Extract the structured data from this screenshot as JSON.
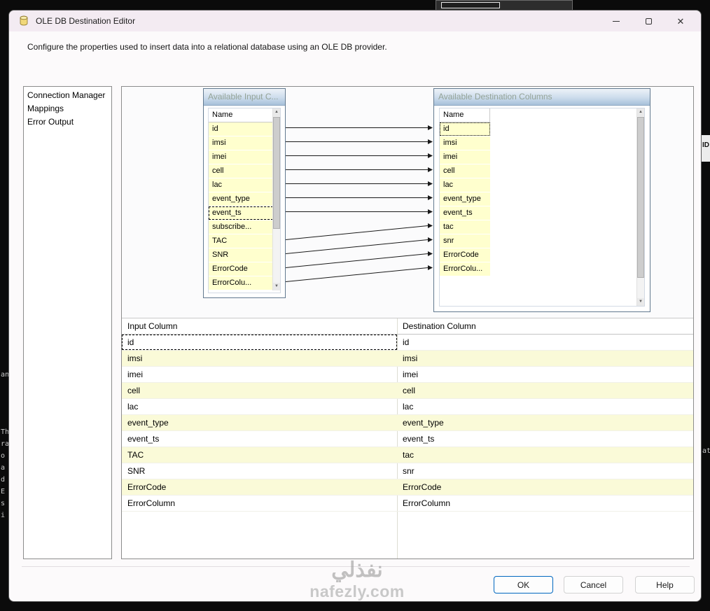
{
  "window": {
    "title": "OLE DB Destination Editor",
    "description": "Configure the properties used to insert data into a relational database using an OLE DB provider."
  },
  "icons": {
    "close": "✕",
    "scroll_up": "▲",
    "scroll_down": "▼"
  },
  "sidebar": {
    "items": [
      {
        "label": "Connection Manager",
        "selected": false
      },
      {
        "label": "Mappings",
        "selected": true
      },
      {
        "label": "Error Output",
        "selected": false
      }
    ]
  },
  "mapping": {
    "input_list": {
      "caption": "Available Input C...",
      "column_header": "Name",
      "rows": [
        "id",
        "imsi",
        "imei",
        "cell",
        "lac",
        "event_type",
        "event_ts",
        "subscribe...",
        "TAC",
        "SNR",
        "ErrorCode",
        "ErrorColu..."
      ],
      "selected_row": "event_ts"
    },
    "destination_list": {
      "caption": "Available Destination Columns",
      "column_header": "Name",
      "rows": [
        "id",
        "imsi",
        "imei",
        "cell",
        "lac",
        "event_type",
        "event_ts",
        "tac",
        "snr",
        "ErrorCode",
        "ErrorColu..."
      ],
      "selected_row": "id"
    },
    "connections": [
      {
        "from": "id",
        "to": "id"
      },
      {
        "from": "imsi",
        "to": "imsi"
      },
      {
        "from": "imei",
        "to": "imei"
      },
      {
        "from": "cell",
        "to": "cell"
      },
      {
        "from": "lac",
        "to": "lac"
      },
      {
        "from": "event_type",
        "to": "event_type"
      },
      {
        "from": "event_ts",
        "to": "event_ts"
      },
      {
        "from": "TAC",
        "to": "tac"
      },
      {
        "from": "SNR",
        "to": "snr"
      },
      {
        "from": "ErrorCode",
        "to": "ErrorCode"
      },
      {
        "from": "ErrorColu...",
        "to": "ErrorColu..."
      }
    ]
  },
  "table": {
    "headers": [
      "Input Column",
      "Destination Column"
    ],
    "focused_input": "id",
    "rows": [
      {
        "input": "id",
        "destination": "id"
      },
      {
        "input": "imsi",
        "destination": "imsi"
      },
      {
        "input": "imei",
        "destination": "imei"
      },
      {
        "input": "cell",
        "destination": "cell"
      },
      {
        "input": "lac",
        "destination": "lac"
      },
      {
        "input": "event_type",
        "destination": "event_type"
      },
      {
        "input": "event_ts",
        "destination": "event_ts"
      },
      {
        "input": "TAC",
        "destination": "tac"
      },
      {
        "input": "SNR",
        "destination": "snr"
      },
      {
        "input": "ErrorCode",
        "destination": "ErrorCode"
      },
      {
        "input": "ErrorColumn",
        "destination": "ErrorColumn"
      }
    ]
  },
  "footer": {
    "ok": "OK",
    "cancel": "Cancel",
    "help": "Help"
  },
  "watermark": {
    "arabic": "نفذلي",
    "domain": "nafezly.com"
  },
  "background": {
    "right_fragment_label": "ID",
    "right_edge_text": "at",
    "left_edge_text": [
      "an",
      "Th",
      "ra",
      "o",
      "a",
      "d",
      "E",
      "s",
      "i"
    ]
  },
  "colors": {
    "accent": "#0067c0",
    "table_row_yellow": "#fafad8",
    "chip_yellow": "#ffffce",
    "titlebar": "#f3ebf2"
  }
}
